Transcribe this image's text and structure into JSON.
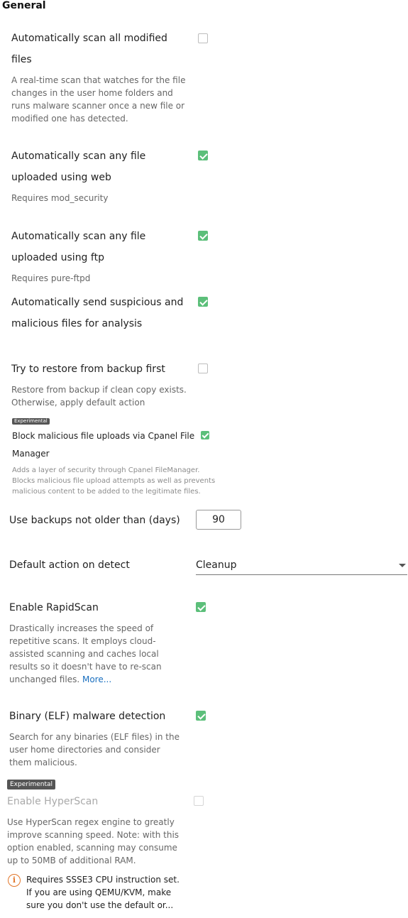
{
  "section": {
    "title": "General"
  },
  "options": {
    "scan_modified": {
      "label_line1": "Automatically scan all modified",
      "label_line2": "files",
      "desc": [
        "A real-time scan that watches for the file",
        "changes in the user home folders and",
        "runs malware scanner once a new file or",
        "modified one has detected."
      ],
      "checked": false
    },
    "scan_web": {
      "label_line1": "Automatically scan any file",
      "label_line2": "uploaded using web",
      "desc": "Requires mod_security",
      "checked": true
    },
    "scan_ftp": {
      "label_line1": "Automatically scan any file",
      "label_line2": "uploaded using ftp",
      "desc": "Requires pure-ftpd",
      "checked": true
    },
    "send_suspicious": {
      "label_line1": "Automatically send suspicious and",
      "label_line2": "malicious files for analysis",
      "checked": true
    },
    "restore_backup": {
      "label": "Try to restore from backup first",
      "desc": [
        "Restore from backup if clean copy exists.",
        "Otherwise, apply default action"
      ],
      "checked": false
    },
    "block_uploads": {
      "badge": "Experimental",
      "label_line1": "Block malicious file uploads via Cpanel File",
      "label_line2": "Manager",
      "desc": [
        "Adds a layer of security through Cpanel FileManager.",
        "Blocks malicious file upload attempts as well as prevents",
        "malicious content to be added to the legitimate files."
      ],
      "checked": true
    },
    "backup_age": {
      "label": "Use backups not older than (days)",
      "value": "90"
    },
    "default_action": {
      "label": "Default action on detect",
      "value": "Cleanup"
    },
    "rapidscan": {
      "label": "Enable RapidScan",
      "desc": [
        "Drastically increases the speed of",
        "repetitive scans. It employs cloud-",
        "assisted scanning and caches local",
        "results so it doesn't have to re-scan"
      ],
      "desc_last": "unchanged files.",
      "more": "More...",
      "checked": true
    },
    "elf": {
      "label": "Binary (ELF) malware detection",
      "desc": [
        "Search for any binaries (ELF files) in the",
        "user home directories and consider",
        "them malicious."
      ],
      "checked": true
    },
    "hyperscan": {
      "badge": "Experimental",
      "label": "Enable HyperScan",
      "desc": [
        "Use HyperScan regex engine to greatly",
        "improve scanning speed. Note: with this",
        "option enabled, scanning may consume",
        "up to 50MB of additional RAM."
      ],
      "note": [
        "Requires SSSE3 CPU instruction set.",
        "If you are using QEMU/KVM, make",
        "sure you don't use the default or..."
      ],
      "info_icon": "i",
      "checked": false,
      "disabled": true
    }
  },
  "colors": {
    "check": "#5cbf7a",
    "link": "#1a6fbf",
    "warning": "#e2762a"
  },
  "icons": {
    "select_caret": "chevron-down-icon",
    "info": "info-circle-icon",
    "check": "check-icon"
  }
}
